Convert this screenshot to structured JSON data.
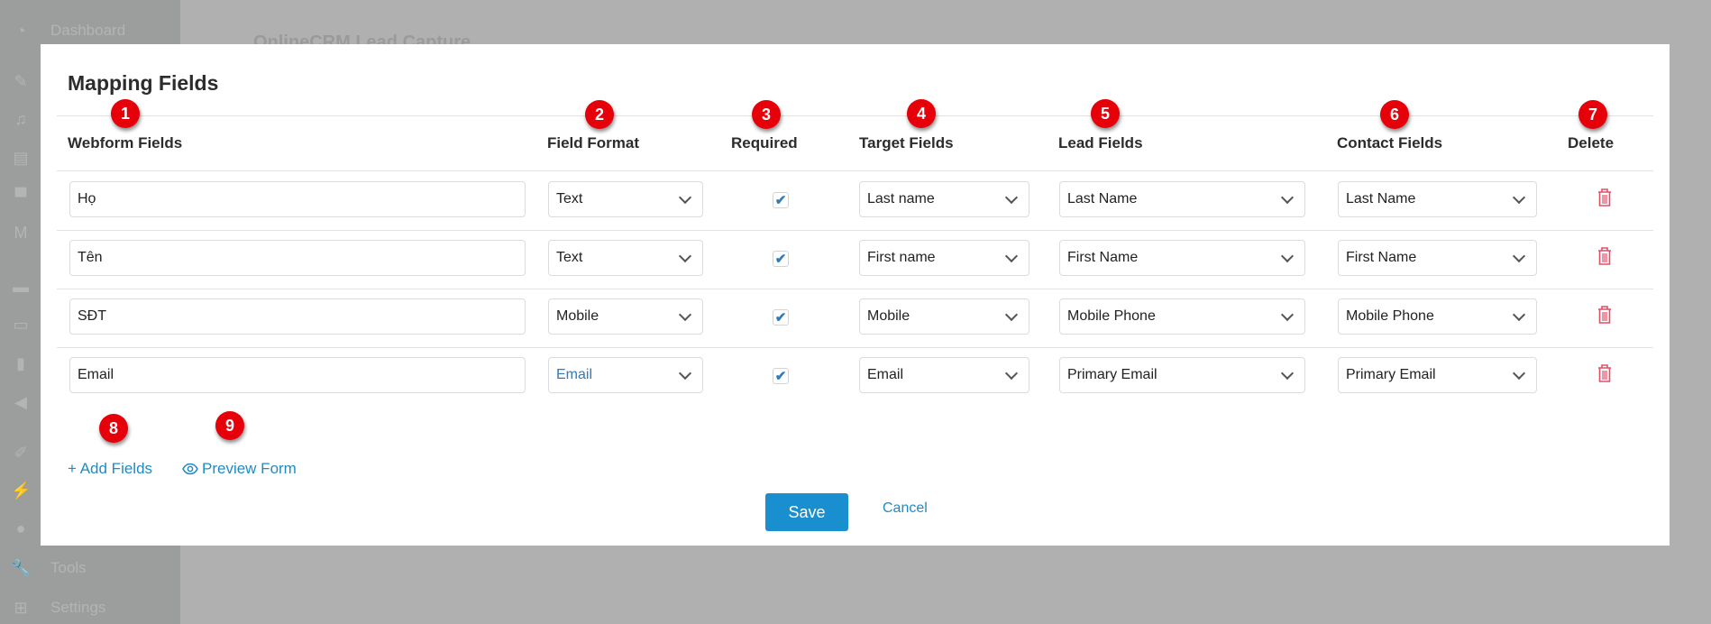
{
  "background": {
    "page_title": "OnlineCRM Lead Capture",
    "sidebar": [
      {
        "label": "Dashboard",
        "icon": "dashboard-icon"
      },
      {
        "label": "",
        "icon": "pin-icon"
      },
      {
        "label": "",
        "icon": "media-icon"
      },
      {
        "label": "",
        "icon": "pages-icon"
      },
      {
        "label": "",
        "icon": "comments-icon"
      },
      {
        "label": "",
        "icon": "m-icon"
      },
      {
        "label": "",
        "icon": "woo-icon"
      },
      {
        "label": "",
        "icon": "archive-icon"
      },
      {
        "label": "",
        "icon": "stats-icon"
      },
      {
        "label": "",
        "icon": "megaphone-icon"
      },
      {
        "label": "",
        "icon": "brush-icon"
      },
      {
        "label": "",
        "icon": "plugin-icon"
      },
      {
        "label": "",
        "icon": "user-icon"
      },
      {
        "label": "Tools",
        "icon": "wrench-icon"
      },
      {
        "label": "Settings",
        "icon": "settings-icon"
      }
    ]
  },
  "modal": {
    "title": "Mapping Fields",
    "columns": [
      "Webform Fields",
      "Field Format",
      "Required",
      "Target Fields",
      "Lead Fields",
      "Contact Fields",
      "Delete"
    ],
    "badges": [
      "1",
      "2",
      "3",
      "4",
      "5",
      "6",
      "7",
      "8",
      "9"
    ],
    "rows": [
      {
        "webform": "Họ",
        "format": "Text",
        "required": true,
        "target": "Last name",
        "lead": "Last Name",
        "contact": "Last Name"
      },
      {
        "webform": "Tên",
        "format": "Text",
        "required": true,
        "target": "First name",
        "lead": "First Name",
        "contact": "First Name"
      },
      {
        "webform": "SĐT",
        "format": "Mobile",
        "required": true,
        "target": "Mobile",
        "lead": "Mobile Phone",
        "contact": "Mobile Phone"
      },
      {
        "webform": "Email",
        "format": "Email",
        "required": true,
        "target": "Email",
        "lead": "Primary Email",
        "contact": "Primary Email"
      }
    ],
    "add_fields_label": "+ Add Fields",
    "preview_form_label": "Preview Form",
    "save_label": "Save",
    "cancel_label": "Cancel",
    "colors": {
      "accent": "#1a8fcf",
      "link": "#1f8bc6",
      "delete": "#e0506a",
      "badge": "#e5000a"
    }
  }
}
